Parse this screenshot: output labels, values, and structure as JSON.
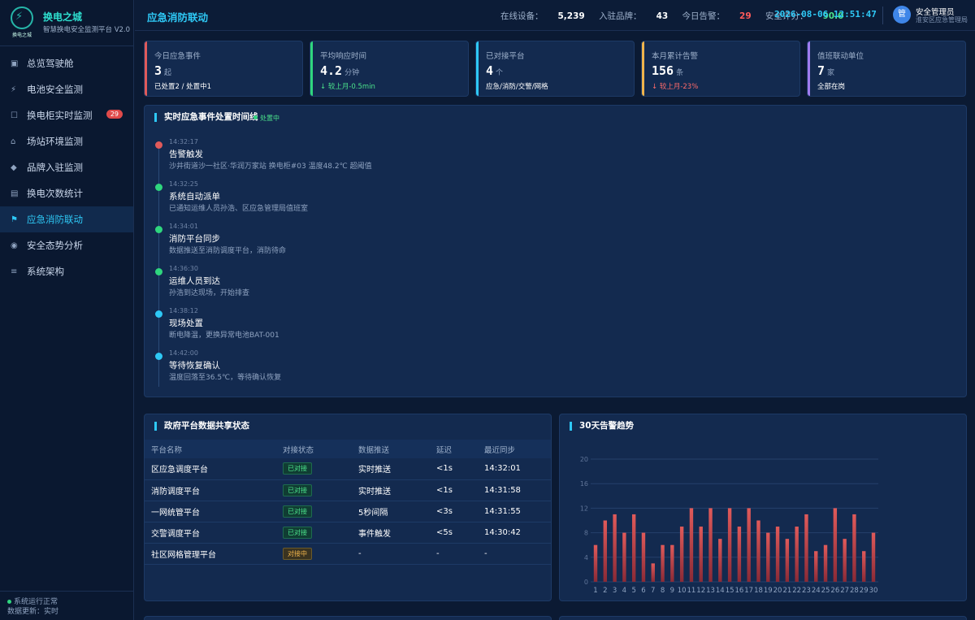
{
  "brand": {
    "name": "换电之城",
    "subtitle": "智慧换电安全监测平台 V2.0",
    "logo_text": "换电之城"
  },
  "nav": [
    {
      "icon": "dashboard-icon",
      "glyph": "▣",
      "label": "总览驾驶舱"
    },
    {
      "icon": "lightning-icon",
      "glyph": "⚡",
      "label": "电池安全监测"
    },
    {
      "icon": "cabinet-icon",
      "glyph": "☐",
      "label": "换电柜实时监测",
      "badge": "29"
    },
    {
      "icon": "home-icon",
      "glyph": "⌂",
      "label": "场站环境监测"
    },
    {
      "icon": "diamond-icon",
      "glyph": "◆",
      "label": "品牌入驻监测"
    },
    {
      "icon": "bar-chart-icon",
      "glyph": "▤",
      "label": "换电次数统计"
    },
    {
      "icon": "flag-icon",
      "glyph": "⚑",
      "label": "应急消防联动",
      "active": true
    },
    {
      "icon": "radar-icon",
      "glyph": "◉",
      "label": "安全态势分析"
    },
    {
      "icon": "menu-icon",
      "glyph": "≡",
      "label": "系统架构"
    }
  ],
  "sidebar_footer": {
    "status": "系统运行正常",
    "update": "数据更新：实时"
  },
  "header": {
    "title": "应急消防联动",
    "online_label": "在线设备：",
    "online_value": "5,239",
    "brands_label": "入驻品牌：",
    "brands_value": "43",
    "alarms_label": "今日告警：",
    "alarms_value": "29",
    "score_label": "安全评分：",
    "score_value": "90.0",
    "clock": "2026-08-06 12:51:47",
    "avatar": "管",
    "user_name": "安全管理员",
    "user_role": "淮安区应急管理局"
  },
  "kpis": [
    {
      "label": "今日应急事件",
      "value": "3",
      "unit": "起",
      "sub": "已处置2 / 处置中1",
      "accent": "#e05a5a",
      "sub_style": ""
    },
    {
      "label": "平均响应时间",
      "value": "4.2",
      "unit": "分钟",
      "sub": "↓ 较上月-0.5min",
      "accent": "#2fd67e",
      "sub_style": "grn"
    },
    {
      "label": "已对接平台",
      "value": "4",
      "unit": "个",
      "sub": "应急/消防/交警/网格",
      "accent": "#2ec8f5",
      "sub_style": ""
    },
    {
      "label": "本月累计告警",
      "value": "156",
      "unit": "条",
      "sub": "↓ 较上月-23%",
      "accent": "#f0b44c",
      "sub_style": "red"
    },
    {
      "label": "值班联动单位",
      "value": "7",
      "unit": "家",
      "sub": "全部在岗",
      "accent": "#a07cf0",
      "sub_style": ""
    }
  ],
  "timeline": {
    "title": "实时应急事件处置时间线",
    "status": "处置中",
    "events": [
      {
        "time": "14:32:17",
        "title": "告警触发",
        "desc": "沙井街道沙一社区·华润万家站 换电柜#03 温度48.2℃ 超阈值",
        "color": "#e05a5a"
      },
      {
        "time": "14:32:25",
        "title": "系统自动派单",
        "desc": "已通知运维人员孙浩、区应急管理局值班室",
        "color": "#2fd67e"
      },
      {
        "time": "14:34:01",
        "title": "消防平台同步",
        "desc": "数据推送至消防调度平台，消防待命",
        "color": "#2fd67e"
      },
      {
        "time": "14:36:30",
        "title": "运维人员到达",
        "desc": "孙浩到达现场，开始排查",
        "color": "#2fd67e"
      },
      {
        "time": "14:38:12",
        "title": "现场处置",
        "desc": "断电降温，更换异常电池BAT-001",
        "color": "#2ec8f5"
      },
      {
        "time": "14:42:00",
        "title": "等待恢复确认",
        "desc": "温度回落至36.5℃，等待确认恢复",
        "color": "#2ec8f5"
      }
    ]
  },
  "gov_table": {
    "title": "政府平台数据共享状态",
    "headers": [
      "平台名称",
      "对接状态",
      "数据推送",
      "延迟",
      "最近同步"
    ],
    "rows": [
      {
        "name": "区应急调度平台",
        "status": "已对接",
        "state": "ok",
        "push": "实时推送",
        "delay": "<1s",
        "sync": "14:32:01"
      },
      {
        "name": "消防调度平台",
        "status": "已对接",
        "state": "ok",
        "push": "实时推送",
        "delay": "<1s",
        "sync": "14:31:58"
      },
      {
        "name": "一网统管平台",
        "status": "已对接",
        "state": "ok",
        "push": "5秒间隔",
        "delay": "<3s",
        "sync": "14:31:55"
      },
      {
        "name": "交警调度平台",
        "status": "已对接",
        "state": "ok",
        "push": "事件触发",
        "delay": "<5s",
        "sync": "14:30:42"
      },
      {
        "name": "社区网格管理平台",
        "status": "对接中",
        "state": "ing",
        "push": "-",
        "delay": "-",
        "sync": "-"
      }
    ]
  },
  "chart_data": {
    "type": "bar",
    "title": "30天告警趋势",
    "categories": [
      "1",
      "2",
      "3",
      "4",
      "5",
      "6",
      "7",
      "8",
      "9",
      "10",
      "11",
      "12",
      "13",
      "14",
      "15",
      "16",
      "17",
      "18",
      "19",
      "20",
      "21",
      "22",
      "23",
      "24",
      "25",
      "26",
      "27",
      "28",
      "29",
      "30"
    ],
    "values": [
      6,
      10,
      11,
      8,
      11,
      8,
      3,
      6,
      6,
      9,
      12,
      9,
      12,
      7,
      12,
      9,
      12,
      10,
      8,
      9,
      7,
      9,
      11,
      5,
      6,
      12,
      7,
      11,
      5,
      8
    ],
    "ylim": [
      0,
      20
    ],
    "yticks": [
      0,
      4,
      8,
      12,
      16,
      20
    ],
    "grid": true,
    "bar_color": "#e05a5a"
  }
}
